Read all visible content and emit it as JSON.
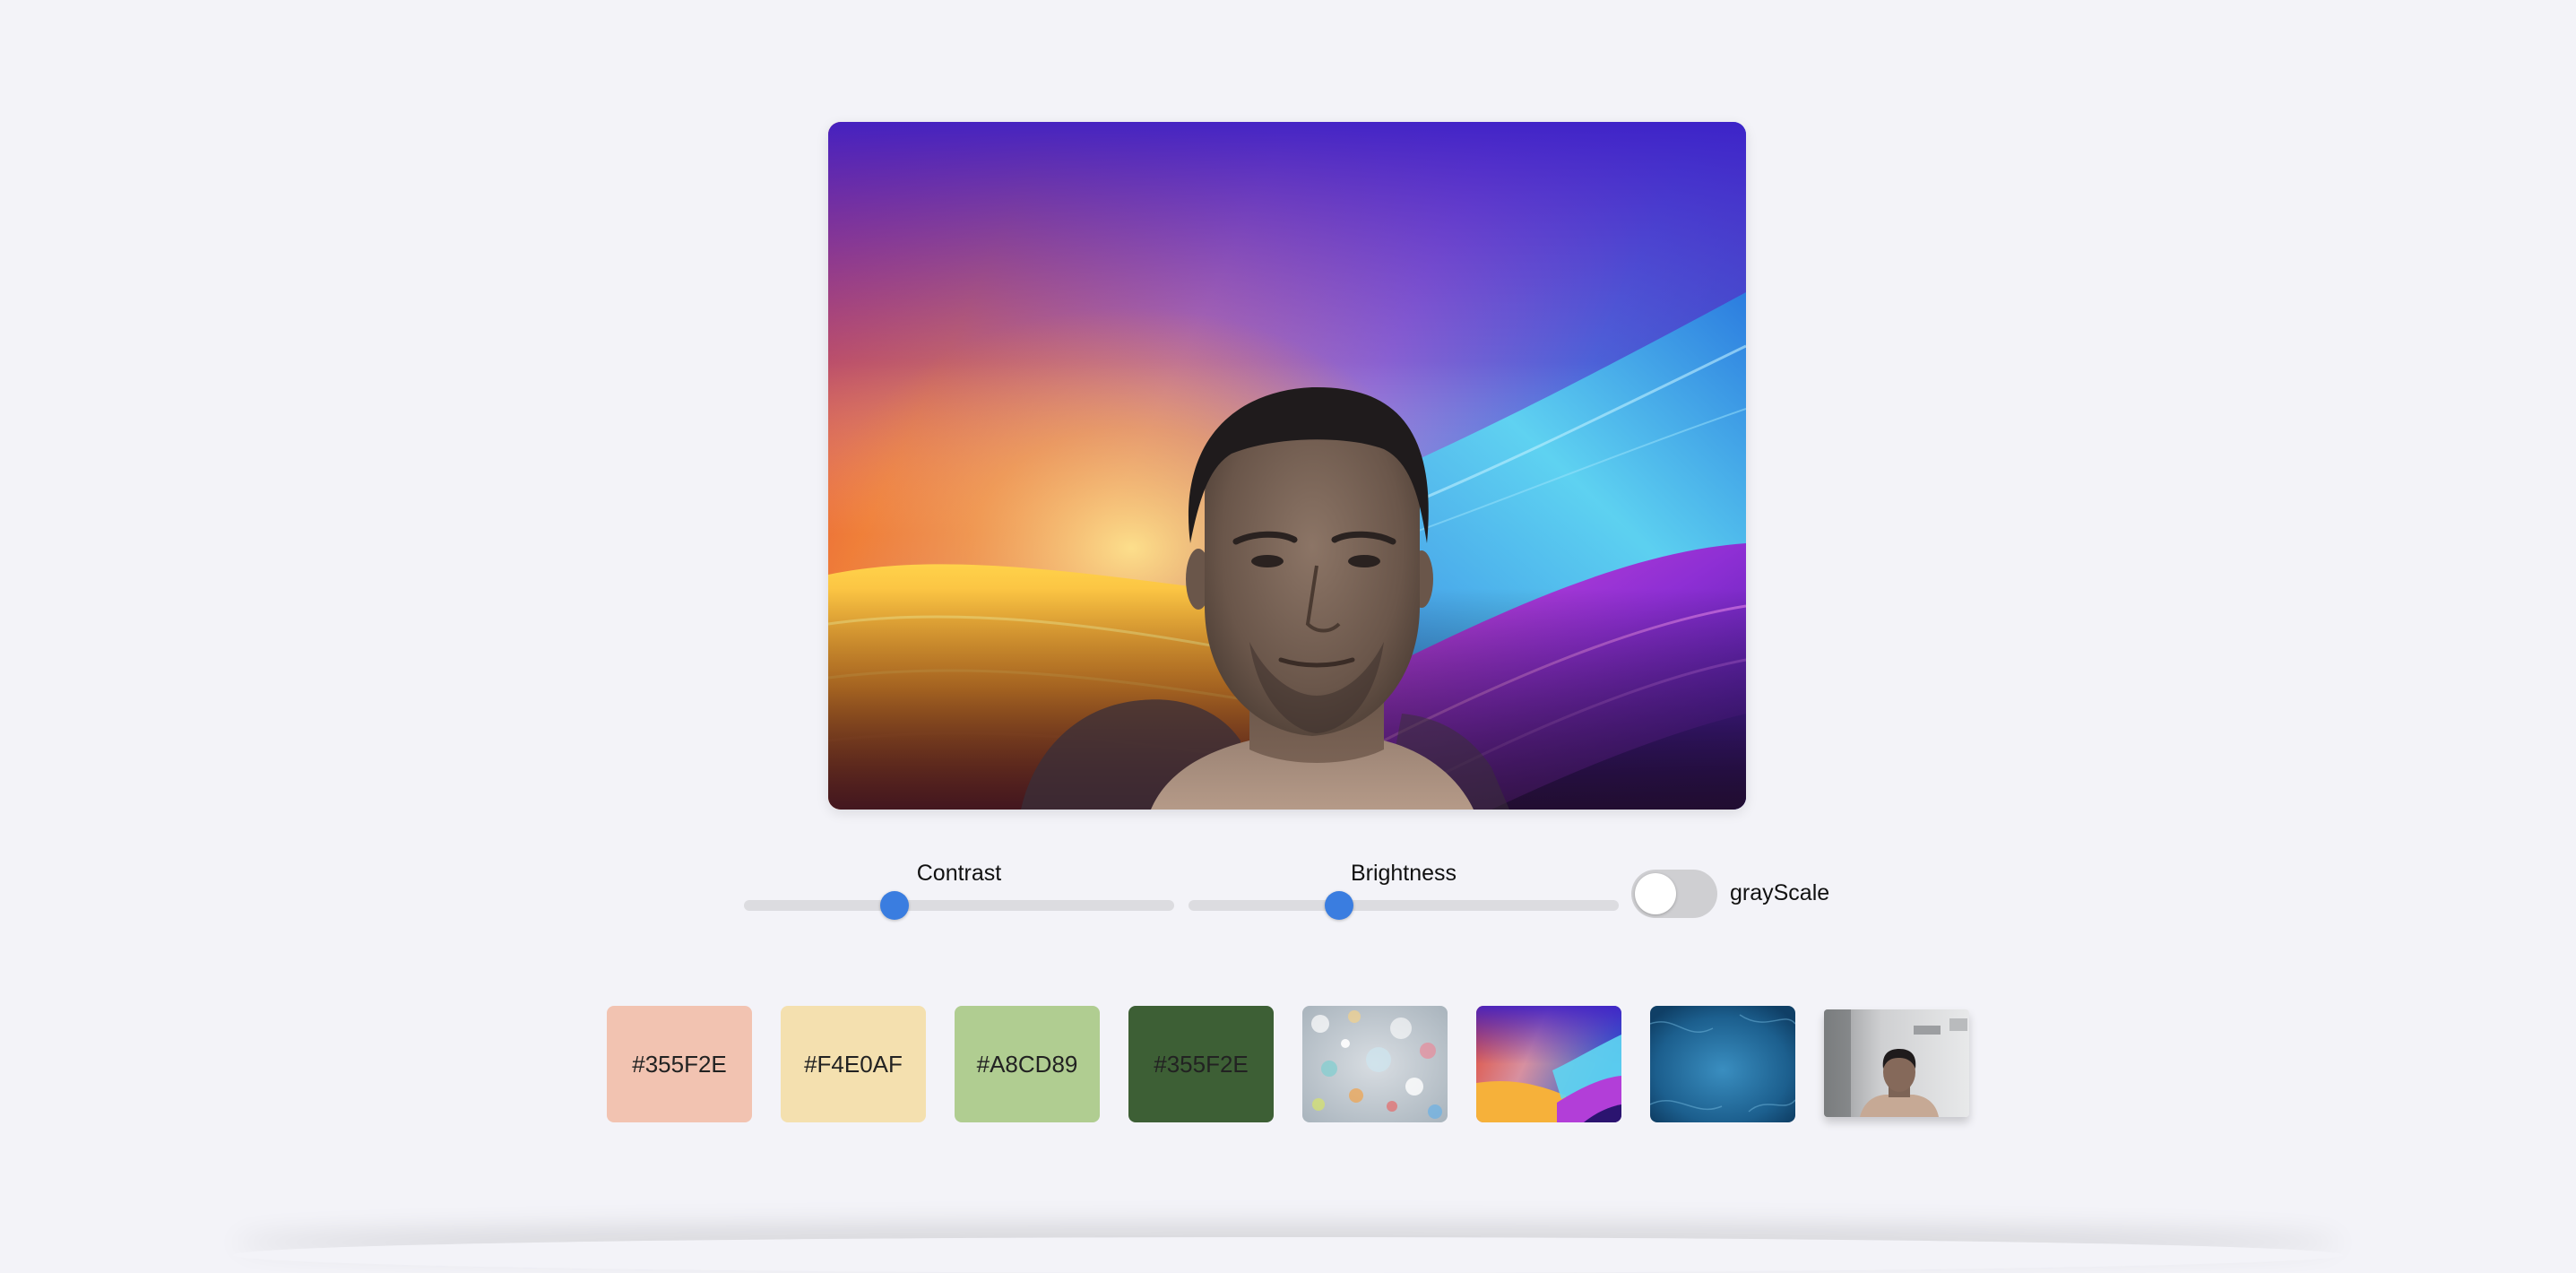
{
  "controls": {
    "contrast": {
      "label": "Contrast",
      "value_fraction": 0.35
    },
    "brightness": {
      "label": "Brightness",
      "value_fraction": 0.35
    },
    "grayscale": {
      "label": "grayScale",
      "on": false
    }
  },
  "backgrounds": [
    {
      "type": "color",
      "label": "#355F2E",
      "color": "#f2c3b1"
    },
    {
      "type": "color",
      "label": "#F4E0AF",
      "color": "#f4e0af"
    },
    {
      "type": "color",
      "label": "#A8CD89",
      "color": "#b0cd91"
    },
    {
      "type": "color",
      "label": "#355F2E",
      "color": "#3d5f35"
    },
    {
      "type": "image",
      "name": "bokeh-lights-image"
    },
    {
      "type": "image",
      "name": "colorful-waves-image"
    },
    {
      "type": "image",
      "name": "blue-texture-image"
    },
    {
      "type": "image",
      "name": "original-camera-image",
      "selected": true
    }
  ],
  "accent_color": "#3a7de0"
}
